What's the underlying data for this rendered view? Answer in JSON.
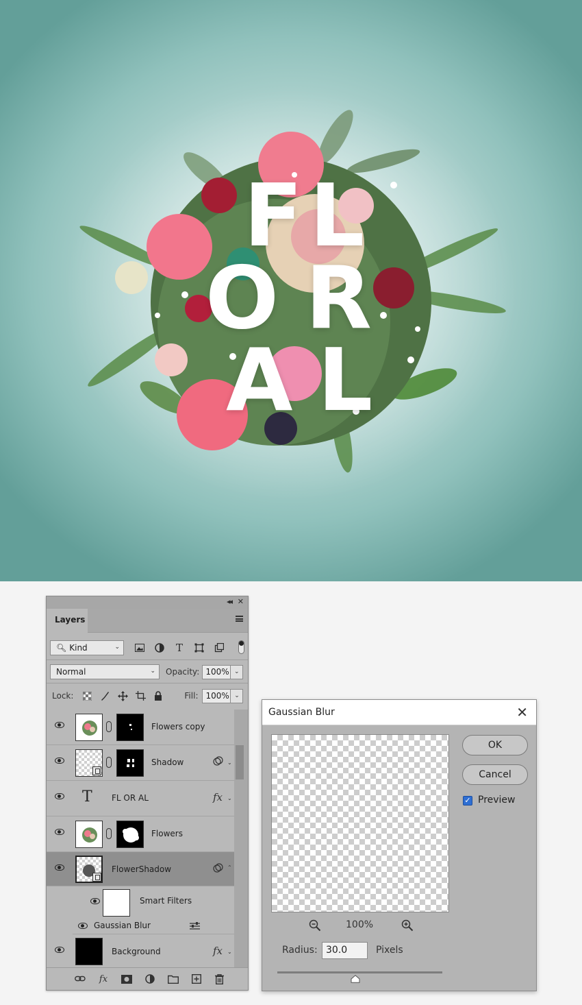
{
  "artwork": {
    "letters": [
      "F",
      "L",
      "O",
      "R",
      "A",
      "L"
    ],
    "background_color": "#8fc0bb"
  },
  "layers_panel": {
    "tab_label": "Layers",
    "filter": {
      "kind_label": "Kind",
      "icons": [
        "image-filter-icon",
        "adjustment-filter-icon",
        "type-filter-icon",
        "shape-filter-icon",
        "smart-object-filter-icon"
      ]
    },
    "blend_mode": "Normal",
    "opacity_label": "Opacity:",
    "opacity_value": "100%",
    "lock_label": "Lock:",
    "fill_label": "Fill:",
    "fill_value": "100%",
    "layers": [
      {
        "name": "Flowers copy"
      },
      {
        "name": "Shadow"
      },
      {
        "name": "FL OR AL"
      },
      {
        "name": "Flowers"
      },
      {
        "name": "FlowerShadow",
        "selected": true
      },
      {
        "name": "Smart Filters"
      },
      {
        "name": "Gaussian Blur"
      },
      {
        "name": "Background"
      }
    ],
    "fx_label": "fx"
  },
  "gaussian_blur": {
    "title": "Gaussian Blur",
    "ok_label": "OK",
    "cancel_label": "Cancel",
    "preview_label": "Preview",
    "preview_checked": true,
    "zoom_level": "100%",
    "radius_label": "Radius:",
    "radius_value": "30.0",
    "radius_unit": "Pixels"
  }
}
